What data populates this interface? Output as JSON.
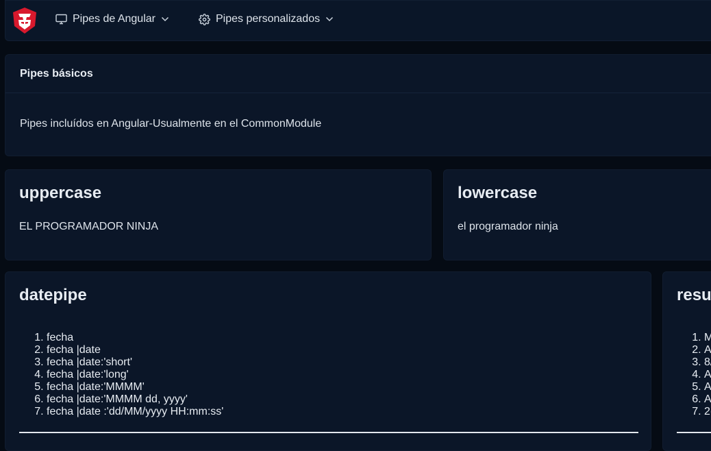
{
  "navbar": {
    "logo_icon": "transformers-shield-icon",
    "menu": [
      {
        "label": "Pipes de Angular",
        "icon": "monitor-icon"
      },
      {
        "label": "Pipes personalizados",
        "icon": "gear-icon"
      }
    ]
  },
  "intro": {
    "header": "Pipes básicos",
    "text": "Pipes incluídos en Angular-Usualmente en el CommonModule"
  },
  "uppercase": {
    "title": "uppercase",
    "text": "EL PROGRAMADOR NINJA"
  },
  "lowercase": {
    "title": "lowercase",
    "text": "el programador ninja"
  },
  "datepipe": {
    "title": "datepipe",
    "items": [
      "fecha",
      "fecha |date",
      "fecha |date:'short'",
      "fecha |date:'long'",
      "fecha |date:'MMMM'",
      "fecha |date:'MMMM dd, yyyy'",
      "fecha |date :'dd/MM/yyyy HH:mm:ss'"
    ]
  },
  "result": {
    "title": "resu",
    "items": [
      "M",
      "A",
      "8/",
      "A",
      "A",
      "A",
      "2("
    ]
  },
  "colors": {
    "background": "#050b14",
    "card": "#0b1628",
    "logo": "#d8192d"
  }
}
